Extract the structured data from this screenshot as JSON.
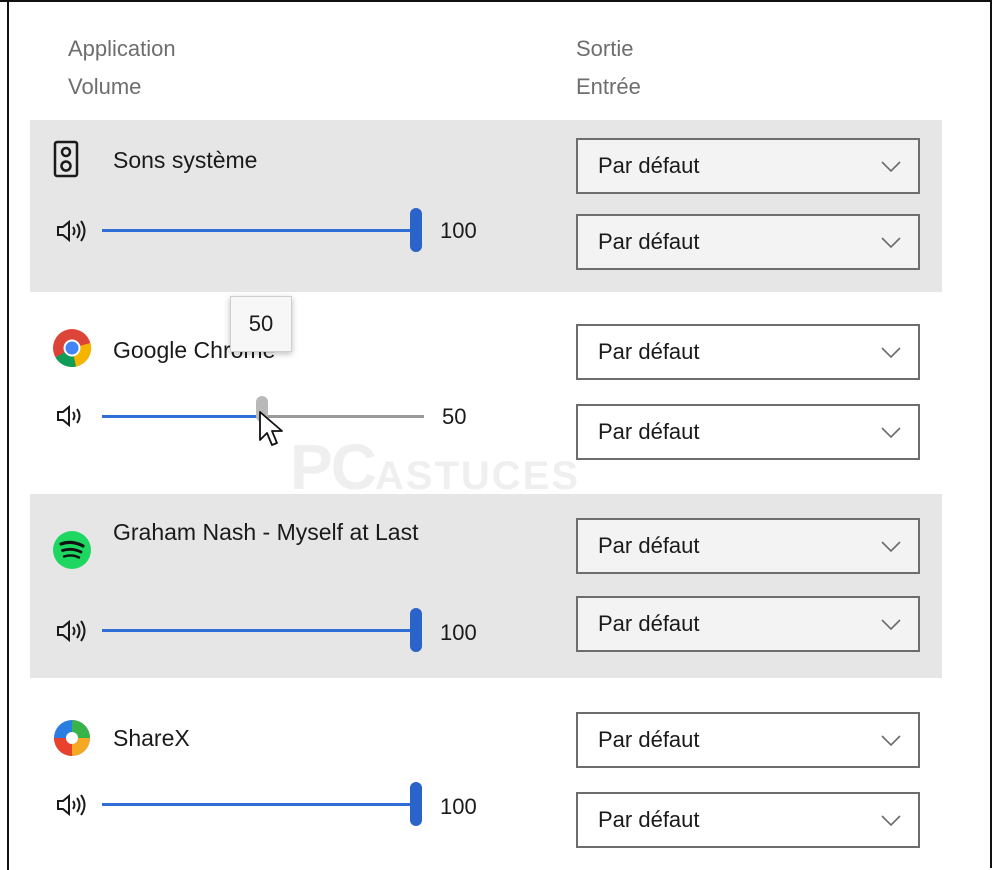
{
  "header": {
    "application_label": "Application",
    "volume_label": "Volume",
    "output_label": "Sortie",
    "input_label": "Entrée"
  },
  "apps": [
    {
      "name": "Sons système",
      "icon": "speaker-device-icon",
      "volume": 100,
      "volume_text": "100",
      "output": "Par défaut",
      "input": "Par défaut"
    },
    {
      "name": "Google Chrome",
      "icon": "chrome-icon",
      "volume": 50,
      "volume_text": "50",
      "output": "Par défaut",
      "input": "Par défaut"
    },
    {
      "name": "Graham Nash - Myself at Last",
      "icon": "spotify-icon",
      "volume": 100,
      "volume_text": "100",
      "output": "Par défaut",
      "input": "Par défaut"
    },
    {
      "name": "ShareX",
      "icon": "sharex-icon",
      "volume": 100,
      "volume_text": "100",
      "output": "Par défaut",
      "input": "Par défaut"
    }
  ],
  "tooltip": {
    "value": "50"
  },
  "watermark": {
    "text_big": "PC",
    "text_small": "ASTUCES"
  },
  "colors": {
    "slider_fill": "#2f6ed6",
    "slider_thumb": "#2a63c9",
    "row_shade": "#e6e6e6"
  }
}
